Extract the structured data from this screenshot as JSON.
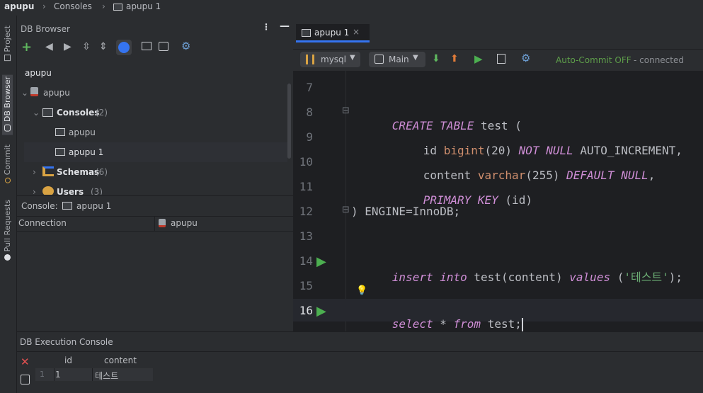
{
  "breadcrumb": {
    "root": "apupu",
    "consoles": "Consoles",
    "console": "apupu 1"
  },
  "side_tabs": {
    "project": "Project",
    "db_browser": "DB Browser",
    "commit": "Commit",
    "pull_requests": "Pull Requests"
  },
  "db_browser": {
    "title": "DB Browser",
    "connection_name": "apupu",
    "tree": [
      {
        "label": "apupu",
        "count": ""
      },
      {
        "label": "Consoles",
        "count": "(2)"
      },
      {
        "label": "apupu",
        "count": ""
      },
      {
        "label": "apupu 1",
        "count": ""
      },
      {
        "label": "Schemas",
        "count": "(6)"
      },
      {
        "label": "Users",
        "count": "(3)"
      }
    ],
    "console_label": "Console:",
    "console_value": "apupu 1",
    "props_col1": "Connection",
    "props_col2": "apupu"
  },
  "editor": {
    "tab_label": "apupu 1",
    "dialect": "mysql",
    "schema": "Main",
    "autocommit": "Auto-Commit OFF",
    "status": "- connected"
  },
  "code_lines": [
    {
      "num": "7"
    },
    {
      "num": "8"
    },
    {
      "num": "9"
    },
    {
      "num": "10"
    },
    {
      "num": "11"
    },
    {
      "num": "12"
    },
    {
      "num": "13"
    },
    {
      "num": "14"
    },
    {
      "num": "15"
    },
    {
      "num": "16"
    }
  ],
  "code": {
    "l8": [
      "CREATE",
      "TABLE",
      "test",
      "("
    ],
    "l9": [
      "id",
      "bigint",
      "(20)",
      "NOT",
      "NULL",
      "AUTO_INCREMENT,"
    ],
    "l10": [
      "content",
      "varchar",
      "(255)",
      "DEFAULT",
      "NULL",
      ","
    ],
    "l11": [
      "PRIMARY",
      "KEY",
      "(id)"
    ],
    "l12": ") ENGINE=InnoDB;",
    "l14": [
      "insert",
      "into",
      "test(content)",
      "values",
      "(",
      "'테스트'",
      ");"
    ],
    "l16": [
      "select",
      "*",
      "from",
      "test;"
    ]
  },
  "console": {
    "title": "DB Execution Console",
    "columns": [
      "id",
      "content"
    ],
    "rows": [
      {
        "rownum": "1",
        "id": "1",
        "content": "테스트"
      }
    ]
  },
  "colors": {
    "accent": "#3574f0",
    "run": "#4caf50",
    "autocommit": "#5e9e4a"
  }
}
